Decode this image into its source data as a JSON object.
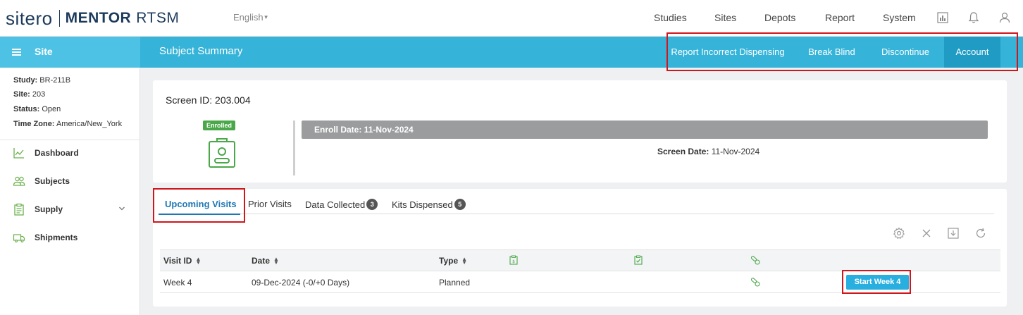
{
  "app": {
    "logo_brand": "sitero",
    "logo_product": "MENTOR",
    "logo_suffix": "RTSM",
    "language": "English"
  },
  "topnav": {
    "items": [
      "Studies",
      "Sites",
      "Depots",
      "Report",
      "System"
    ],
    "icons": [
      "report-chart-icon",
      "bell-icon",
      "user-icon"
    ]
  },
  "site_header": {
    "title": "Site"
  },
  "page": {
    "title": "Subject Summary"
  },
  "actions": [
    {
      "label": "Report Incorrect Dispensing",
      "active": false
    },
    {
      "label": "Break Blind",
      "active": false
    },
    {
      "label": "Discontinue",
      "active": false
    },
    {
      "label": "Account",
      "active": true
    }
  ],
  "sidebar": {
    "info": [
      {
        "label": "Study:",
        "value": "BR-211B"
      },
      {
        "label": "Site:",
        "value": "203"
      },
      {
        "label": "Status:",
        "value": "Open"
      },
      {
        "label": "Time Zone:",
        "value": "America/New_York"
      }
    ],
    "items": [
      {
        "label": "Dashboard",
        "icon": "chart-line-icon"
      },
      {
        "label": "Subjects",
        "icon": "users-icon"
      },
      {
        "label": "Supply",
        "icon": "clipboard-list-icon"
      },
      {
        "label": "Shipments",
        "icon": "truck-icon"
      }
    ]
  },
  "subject": {
    "screen_id": "Screen ID: 203.004",
    "status_badge": "Enrolled",
    "enroll_date": "Enroll Date: 11-Nov-2024",
    "screen_date_label": "Screen Date:",
    "screen_date_value": "11-Nov-2024"
  },
  "tabs": [
    {
      "label": "Upcoming Visits",
      "active": true,
      "count": null
    },
    {
      "label": "Prior Visits",
      "active": false,
      "count": null
    },
    {
      "label": "Data Collected",
      "active": false,
      "count": "3"
    },
    {
      "label": "Kits Dispensed",
      "active": false,
      "count": "5"
    }
  ],
  "toolbar": {
    "icons": [
      "gear-icon",
      "close-icon",
      "download-icon",
      "refresh-icon"
    ]
  },
  "table": {
    "columns": [
      "Visit ID",
      "Date",
      "Type"
    ],
    "rows": [
      {
        "visit_id": "Week 4",
        "date": "09-Dec-2024 (-0/+0 Days)",
        "type": "Planned",
        "button": "Start Week 4"
      }
    ]
  },
  "colors": {
    "accent_blue": "#35b3d8",
    "active_action": "#1f9bc4",
    "enrolled_green": "#4ba84a",
    "highlight_red": "#d0151b",
    "start_button": "#29aee0"
  }
}
